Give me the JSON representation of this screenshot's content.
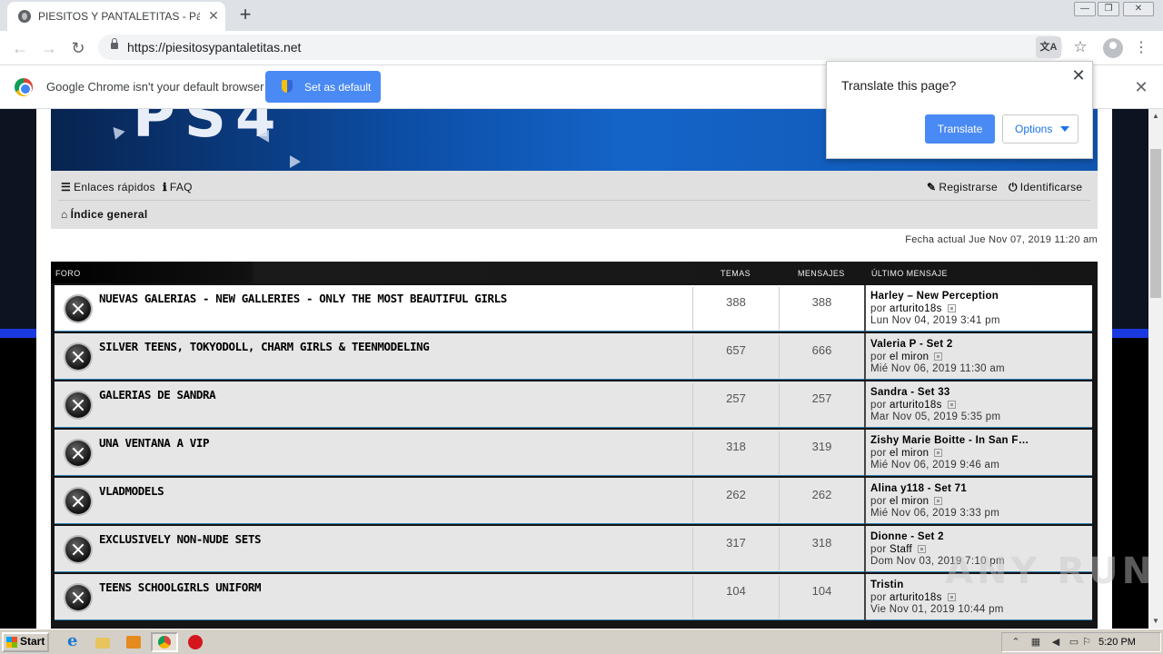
{
  "browser": {
    "tab_title": "PIESITOS Y PANTALETITAS - Página",
    "url": "https://piesitosypantaletitas.net",
    "new_tab_symbol": "+",
    "tab_close_symbol": "✕"
  },
  "infobar": {
    "message": "Google Chrome isn't your default browser",
    "button_label": "Set as default",
    "close_symbol": "✕"
  },
  "translate_popup": {
    "title": "Translate this page?",
    "translate_label": "Translate",
    "options_label": "Options",
    "close_symbol": "✕"
  },
  "forum": {
    "nav": {
      "quick_links": "Enlaces rápidos",
      "faq": "FAQ",
      "register": "Registrarse",
      "login": "Identificarse",
      "board_index": "Índice general"
    },
    "current_date": "Fecha actual Jue Nov 07, 2019 11:20 am",
    "headers": {
      "forum": "FORO",
      "topics": "TEMAS",
      "posts": "MENSAJES",
      "last_post": "ÚLTIMO MENSAJE"
    },
    "rows": [
      {
        "title": "NUEVAS GALERIAS - NEW GALLERIES - ONLY THE MOST BEAUTIFUL GIRLS",
        "topics": "388",
        "posts": "388",
        "last_title": "Harley – New Perception",
        "by_prefix": "por",
        "last_user": "arturito18s",
        "last_date": "Lun Nov 04, 2019 3:41 pm"
      },
      {
        "title": "SILVER TEENS, TOKYODOLL, CHARM GIRLS & TEENMODELING",
        "topics": "657",
        "posts": "666",
        "last_title": "Valeria P - Set 2",
        "by_prefix": "por",
        "last_user": "el miron",
        "last_date": "Mié Nov 06, 2019 11:30 am"
      },
      {
        "title": "GALERIAS DE SANDRA",
        "topics": "257",
        "posts": "257",
        "last_title": "Sandra - Set 33",
        "by_prefix": "por",
        "last_user": "arturito18s",
        "last_date": "Mar Nov 05, 2019 5:35 pm"
      },
      {
        "title": "UNA VENTANA A VIP",
        "topics": "318",
        "posts": "319",
        "last_title": "Zishy Marie Boitte - In San F…",
        "by_prefix": "por",
        "last_user": "el miron",
        "last_date": "Mié Nov 06, 2019 9:46 am"
      },
      {
        "title": "VLADMODELS",
        "topics": "262",
        "posts": "262",
        "last_title": "Alina y118 - Set 71",
        "by_prefix": "por",
        "last_user": "el miron",
        "last_date": "Mié Nov 06, 2019 3:33 pm"
      },
      {
        "title": "EXCLUSIVELY NON-NUDE SETS",
        "topics": "317",
        "posts": "318",
        "last_title": "Dionne - Set 2",
        "by_prefix": "por",
        "last_user": "Staff",
        "last_date": "Dom Nov 03, 2019 7:10 pm"
      },
      {
        "title": "TEENS SCHOOLGIRLS UNIFORM",
        "topics": "104",
        "posts": "104",
        "last_title": "Tristin",
        "by_prefix": "por",
        "last_user": "arturito18s",
        "last_date": "Vie Nov 01, 2019 10:44 pm"
      }
    ]
  },
  "taskbar": {
    "start_label": "Start",
    "time": "5:20 PM"
  },
  "watermark": "ANY RUN"
}
